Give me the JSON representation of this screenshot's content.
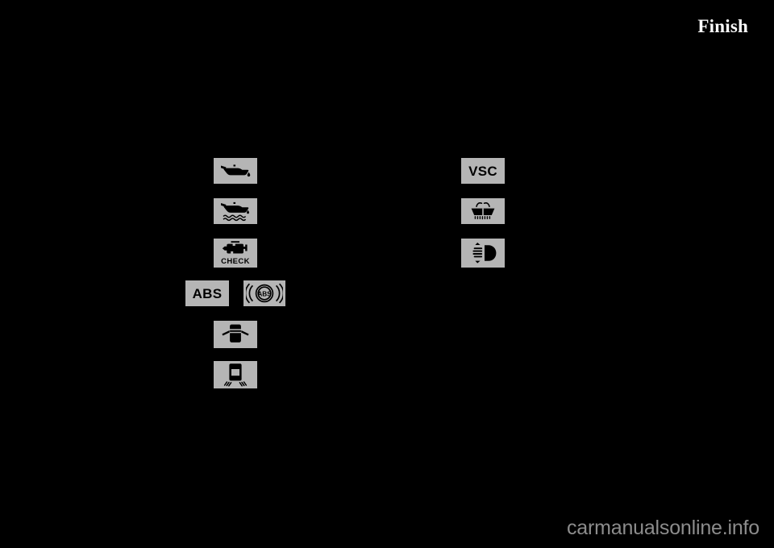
{
  "page": {
    "title": "Finish",
    "background_color": "#000000",
    "tile_color": "#b5b5b5",
    "glyph_color": "#000000",
    "title_color": "#ffffff",
    "watermark_color": "#8c8c8c"
  },
  "watermark": {
    "text": "carmanualsonline.info"
  },
  "indicator_columns": {
    "left": [
      {
        "id": "oil-pressure",
        "icon": "oil-can-icon",
        "label": ""
      },
      {
        "id": "oil-level",
        "icon": "oil-can-level-icon",
        "label": ""
      },
      {
        "id": "check-engine",
        "icon": "engine-icon",
        "label": "CHECK"
      },
      {
        "id": "abs-text",
        "icon": "abs-text-icon",
        "label": "ABS"
      },
      {
        "id": "abs-circle",
        "icon": "abs-brake-circle-icon",
        "label": "ABS"
      },
      {
        "id": "door-ajar",
        "icon": "door-ajar-car-icon",
        "label": ""
      },
      {
        "id": "skid-control",
        "icon": "skid-car-icon",
        "label": ""
      }
    ],
    "right": [
      {
        "id": "vsc",
        "icon": "vsc-text-icon",
        "label": "VSC"
      },
      {
        "id": "washer-fluid",
        "icon": "washer-fluid-icon",
        "label": ""
      },
      {
        "id": "headlamp",
        "icon": "headlamp-icon",
        "label": ""
      }
    ]
  }
}
